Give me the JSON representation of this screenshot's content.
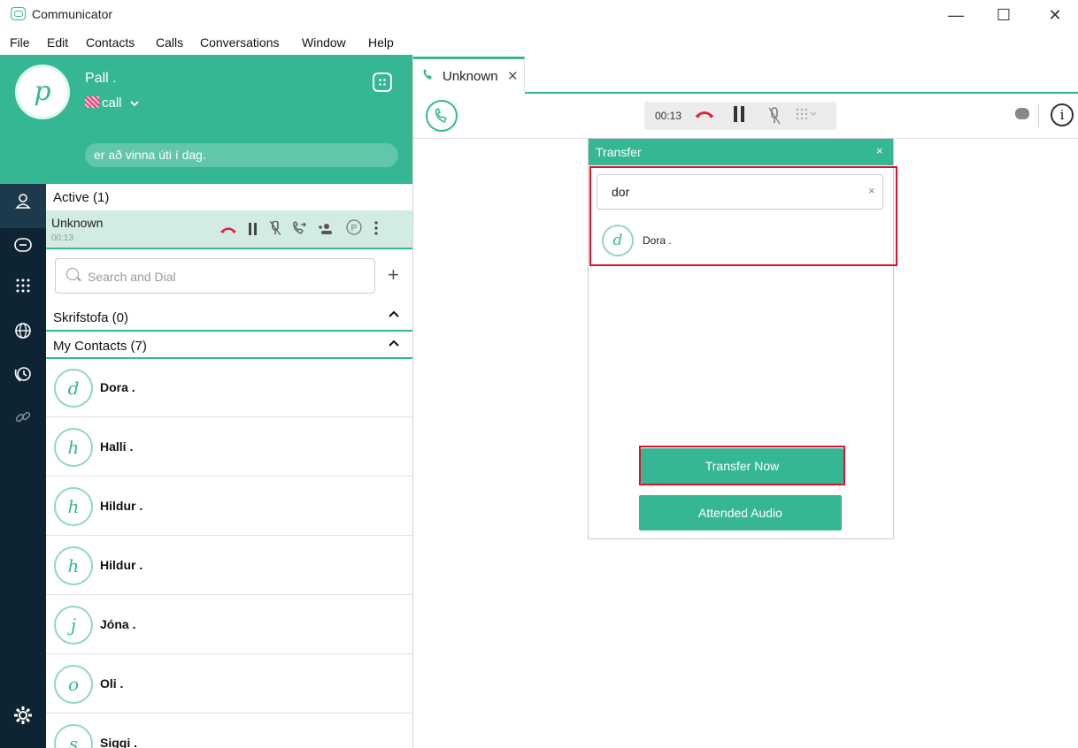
{
  "app": {
    "title": "Communicator",
    "icon": "chat-bubble-icon"
  },
  "window": {
    "minimize": "—",
    "maximize": "☐",
    "close": "✕"
  },
  "menu": [
    "File",
    "Edit",
    "Contacts",
    "Calls",
    "Conversations",
    "Window",
    "Help"
  ],
  "profile": {
    "initial": "p",
    "name": "Pall .",
    "status": "call",
    "note": "er að vinna úti í dag."
  },
  "rail": {
    "items": [
      "contacts-icon",
      "chat-icon",
      "dialpad-icon",
      "globe-icon",
      "call-history-icon",
      "link-icon"
    ],
    "settings": "settings-icon"
  },
  "active": {
    "header": "Active (1)",
    "call": {
      "name": "Unknown",
      "time": "00:13"
    }
  },
  "search": {
    "placeholder": "Search and Dial",
    "add": "+"
  },
  "groups": {
    "office": "Skrifstofa (0)",
    "contacts": "My Contacts (7)"
  },
  "contacts": [
    {
      "initial": "d",
      "name": "Dora ."
    },
    {
      "initial": "h",
      "name": "Halli ."
    },
    {
      "initial": "h",
      "name": "Hildur ."
    },
    {
      "initial": "h",
      "name": "Hildur ."
    },
    {
      "initial": "j",
      "name": "Jóna ."
    },
    {
      "initial": "o",
      "name": "Oli ."
    },
    {
      "initial": "s",
      "name": "Siggi ."
    }
  ],
  "tab": {
    "label": "Unknown",
    "close": "✕"
  },
  "call_controls": {
    "time": "00:13"
  },
  "transfer": {
    "title": "Transfer",
    "close": "×",
    "input_value": "dor",
    "clear": "×",
    "result": {
      "initial": "d",
      "name": "Dora ."
    },
    "transfer_now": "Transfer Now",
    "attended_audio": "Attended Audio"
  },
  "colors": {
    "accent": "#36b793",
    "rail": "#0f2433",
    "hangup": "#e0203a",
    "highlight": "#e0102c"
  }
}
